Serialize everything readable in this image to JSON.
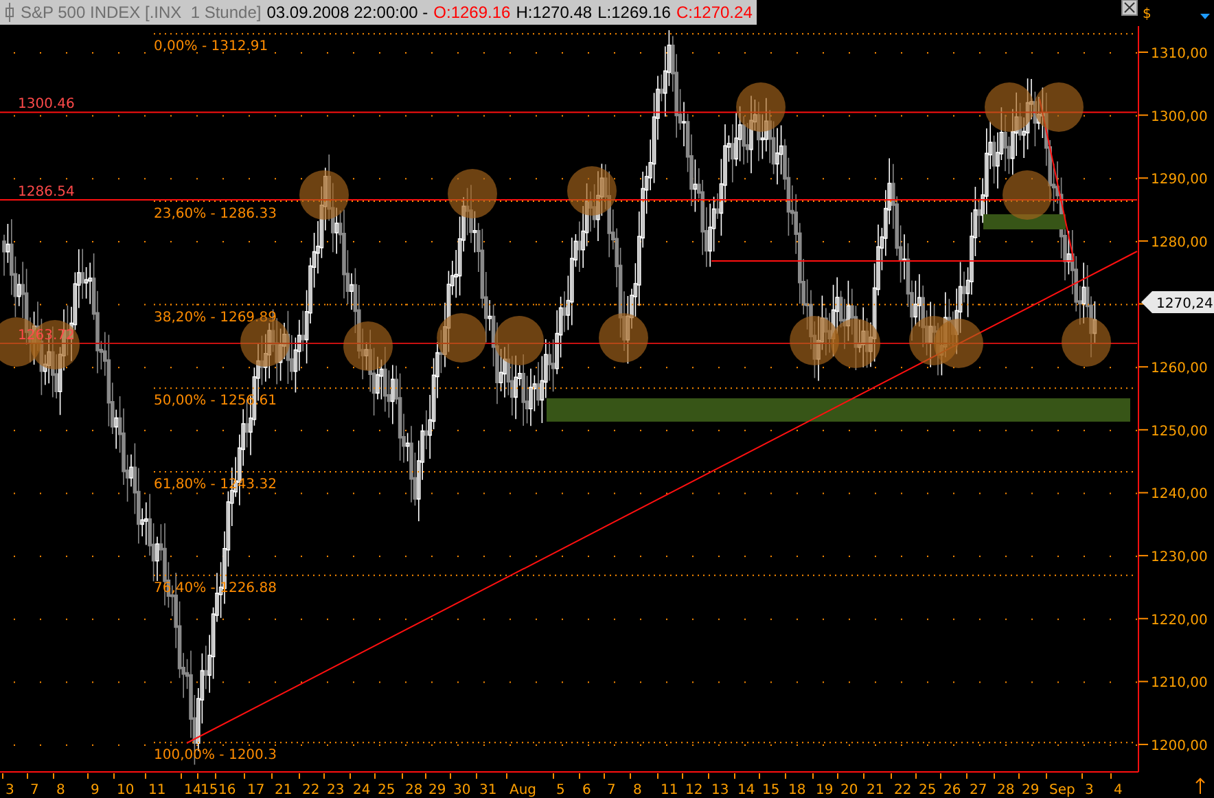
{
  "header": {
    "title": "S&P 500 INDEX [.INX  1 Stunde]",
    "datetime": "03.09.2008 22:00:00 -",
    "open": "O:1269.16",
    "high": "H:1270.48",
    "low": "L:1269.16",
    "close": "C:1270.24"
  },
  "price_axis": {
    "currency": "$",
    "ticks": [
      "1310,00",
      "1300,00",
      "1290,00",
      "1280,00",
      "1260,00",
      "1250,00",
      "1240,00",
      "1230,00",
      "1220,00",
      "1210,00",
      "1200,00"
    ],
    "last_price": "1270,24"
  },
  "time_axis": {
    "ticks": [
      "3",
      "7",
      "8",
      "9",
      "10",
      "11",
      "14",
      "15",
      "16",
      "17",
      "21",
      "22",
      "23",
      "24",
      "25",
      "28",
      "29",
      "30",
      "31",
      "Aug",
      "5",
      "6",
      "7",
      "8",
      "11",
      "12",
      "13",
      "14",
      "15",
      "18",
      "19",
      "20",
      "21",
      "22",
      "25",
      "26",
      "27",
      "28",
      "29",
      "Sep",
      "3",
      "4"
    ]
  },
  "fibonacci_levels": [
    {
      "label": "0,00% - 1312.91"
    },
    {
      "label": "23,60% - 1286.33"
    },
    {
      "label": "38,20% - 1269.89"
    },
    {
      "label": "50,00% - 1256.61"
    },
    {
      "label": "61,80% - 1243.32"
    },
    {
      "label": "76,40% - 1226.88"
    },
    {
      "label": "100,00% - 1200.3"
    }
  ],
  "horizontal_lines": [
    {
      "label": "1300.46"
    },
    {
      "label": "1286.54"
    },
    {
      "label": "1263.72"
    }
  ]
}
